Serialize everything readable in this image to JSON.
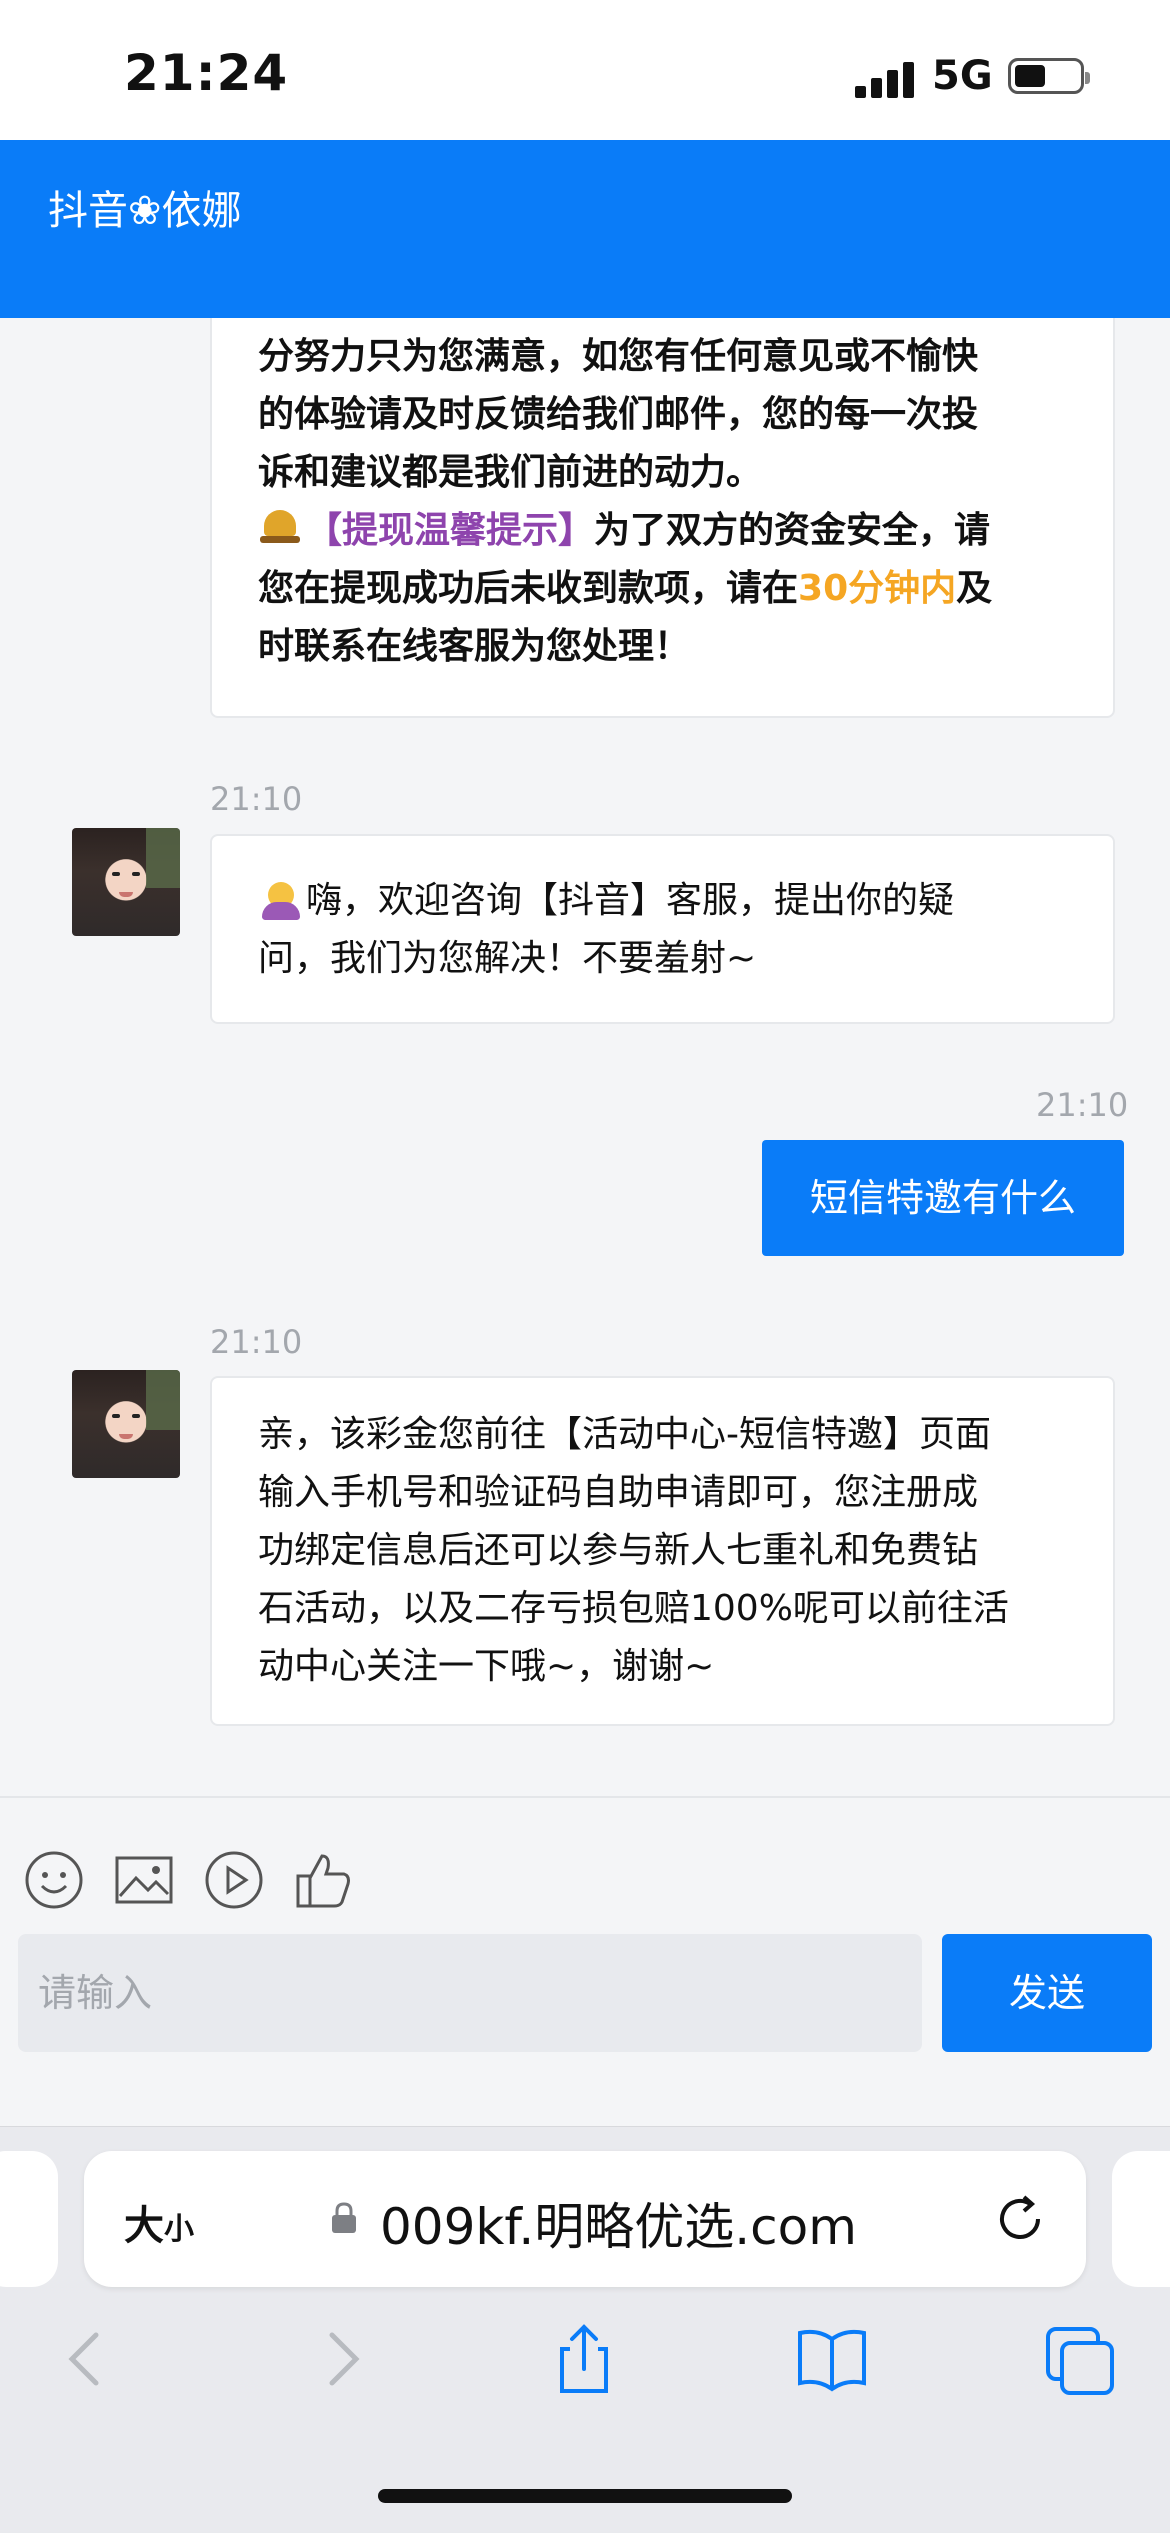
{
  "status_bar": {
    "time": "21:24",
    "network": "5G"
  },
  "header": {
    "title": "抖音❀依娜"
  },
  "messages": {
    "m1": {
      "line1": "分努力只为您满意，如您有任何意见或不愉快",
      "line2": "的体验请及时反馈给我们邮件，您的每一次投",
      "line3": "诉和建议都是我们前进的动力。",
      "tip_title": "【提现温馨提示】",
      "tip_a": "为了双方的资金安全，请",
      "tip_b": "您在提现成功后未收到款项，请在",
      "tip_highlight": "30分钟内",
      "tip_c": "及",
      "tip_d": "时联系在线客服为您处理！"
    },
    "m2": {
      "time": "21:10",
      "line1": "嗨，欢迎咨询【抖音】客服，提出你的疑",
      "line2": "问，我们为您解决！不要羞射~"
    },
    "m3": {
      "time": "21:10",
      "text": "短信特邀有什么"
    },
    "m4": {
      "time": "21:10",
      "line1": "亲，该彩金您前往【活动中心-短信特邀】页面",
      "line2": "输入手机号和验证码自助申请即可，您注册成",
      "line3": "功绑定信息后还可以参与新人七重礼和免费钻",
      "line4": "石活动，以及二存亏损包赔100%呢可以前往活",
      "line5": "动中心关注一下哦~，谢谢~"
    }
  },
  "composer": {
    "icons": [
      "emoji-icon",
      "image-icon",
      "video-icon",
      "thumbs-up-icon"
    ],
    "placeholder": "请输入",
    "send_label": "发送"
  },
  "browser": {
    "text_size_label_big": "大",
    "text_size_label_small": "小",
    "url": "009kf.明略优选.com"
  },
  "colors": {
    "accent": "#0a7cf8",
    "tip_purple": "#8e44ad",
    "highlight_orange": "#f5a623"
  }
}
